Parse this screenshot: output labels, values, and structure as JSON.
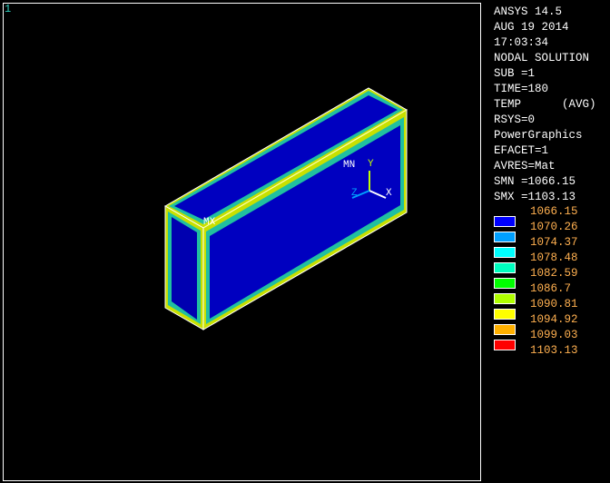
{
  "window_number": "1",
  "info_lines": [
    "ANSYS 14.5",
    "AUG 19 2014",
    "17:03:34",
    "NODAL SOLUTION",
    "SUB =1",
    "TIME=180",
    "TEMP      (AVG)",
    "RSYS=0",
    "PowerGraphics",
    "EFACET=1",
    "AVRES=Mat",
    "SMN =1066.15",
    "SMX =1103.13"
  ],
  "legend": {
    "values": [
      "1066.15",
      "1070.26",
      "1074.37",
      "1078.48",
      "1082.59",
      "1086.7",
      "1090.81",
      "1094.92",
      "1099.03",
      "1103.13"
    ],
    "colors": [
      "#0000ff",
      "#00a0ff",
      "#00ffff",
      "#00ffc0",
      "#00ff00",
      "#b0ff00",
      "#ffff00",
      "#ffb000",
      "#ff0000"
    ]
  },
  "plot_labels": {
    "min": "MN",
    "max": "MX",
    "axis_x": "X",
    "axis_y": "Y",
    "axis_z": "Z"
  }
}
